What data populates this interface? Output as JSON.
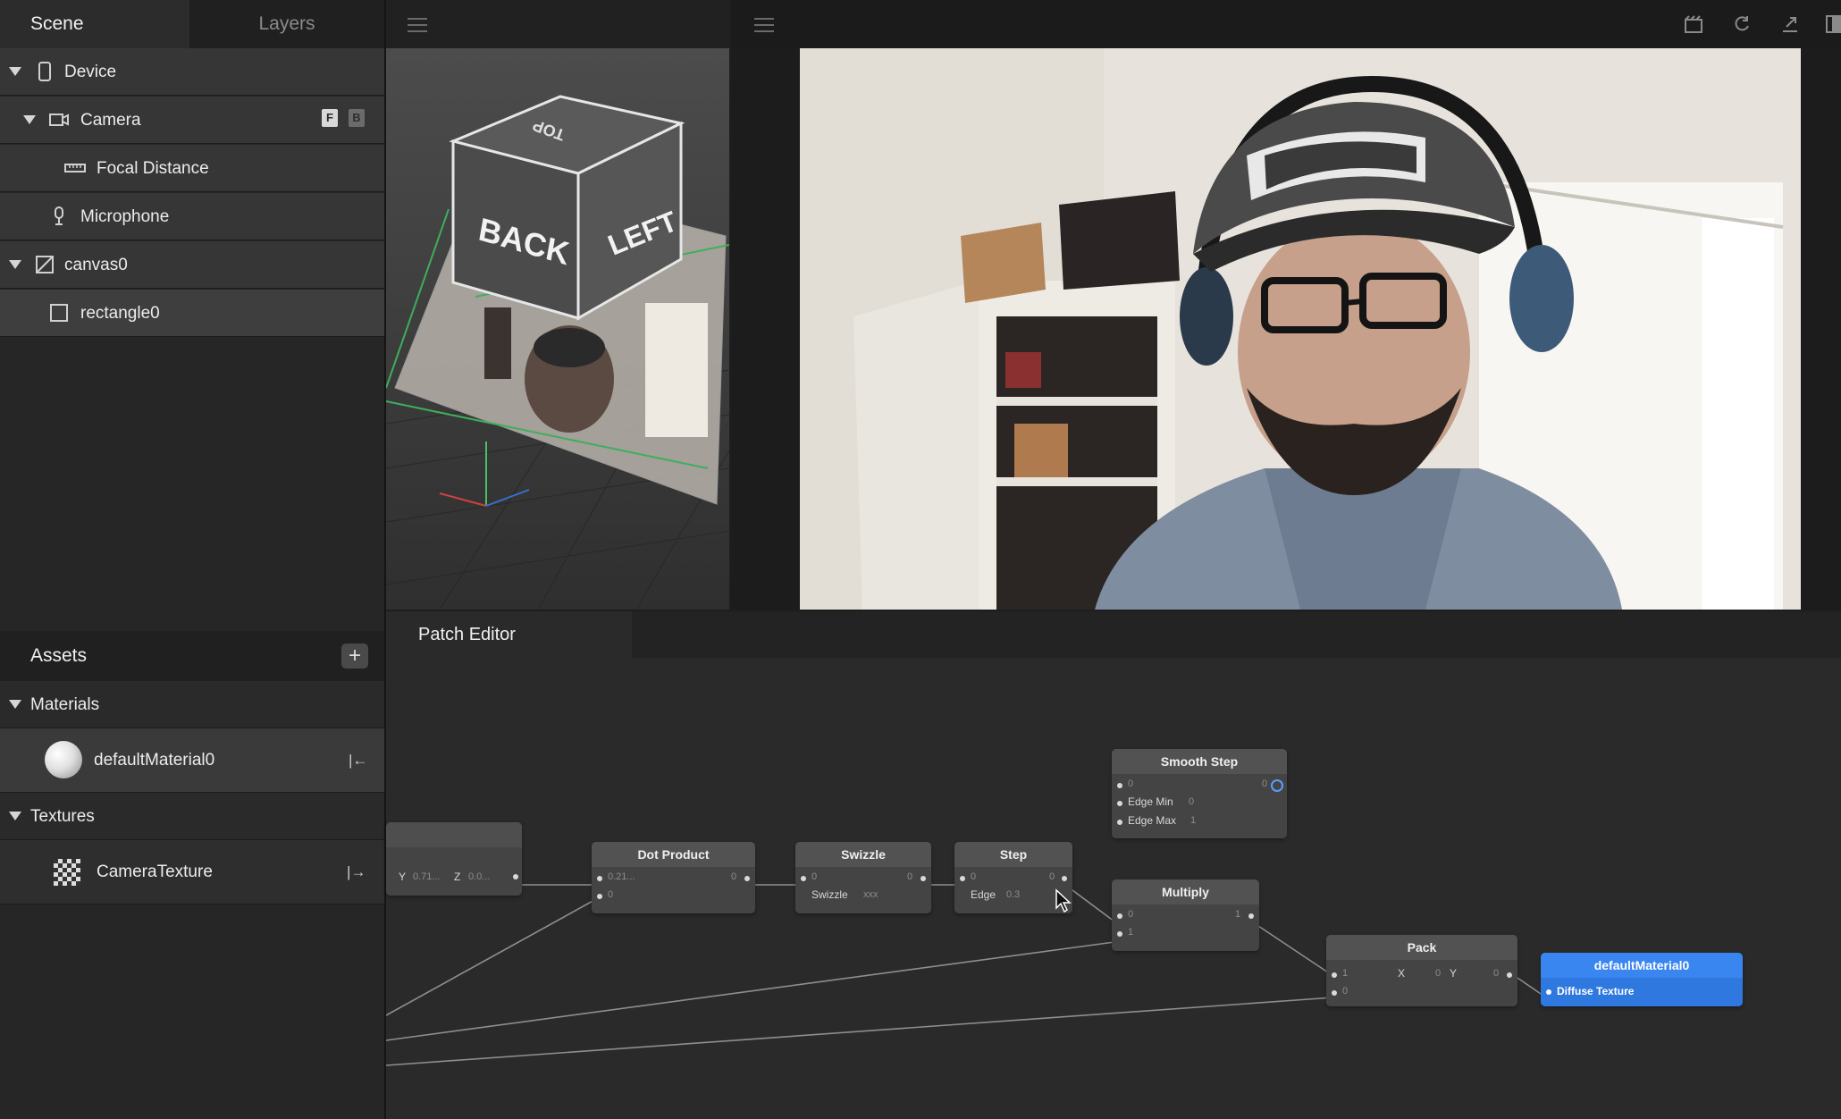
{
  "sidebar": {
    "tabs": [
      "Scene",
      "Layers"
    ],
    "scene_items": [
      {
        "label": "Device",
        "icon": "phone-icon"
      },
      {
        "label": "Camera",
        "icon": "camera-icon",
        "flags": [
          "F",
          "B"
        ]
      },
      {
        "label": "Focal Distance",
        "icon": "ruler-icon"
      },
      {
        "label": "Microphone",
        "icon": "microphone-icon"
      },
      {
        "label": "canvas0",
        "icon": "canvas-icon"
      },
      {
        "label": "rectangle0",
        "icon": "rectangle-icon"
      }
    ],
    "assets": {
      "title": "Assets",
      "add_label": "+",
      "materials_label": "Materials",
      "material": "defaultMaterial0",
      "material_action": "|←",
      "textures_label": "Textures",
      "texture": "CameraTexture",
      "texture_action": "|→"
    }
  },
  "viewport": {
    "cube_faces": {
      "top": "TOP",
      "back": "BACK",
      "left": "LEFT"
    }
  },
  "patch_editor": {
    "title": "Patch Editor",
    "nodes": {
      "partial": {
        "y_label": "Y",
        "y_value": "0.71...",
        "z_label": "Z",
        "z_value": "0.0..."
      },
      "dot_product": {
        "title": "Dot Product",
        "in1": "0.21...",
        "in2": "0",
        "out": "0"
      },
      "swizzle": {
        "title": "Swizzle",
        "in1": "0",
        "param_label": "Swizzle",
        "param_value": "xxx",
        "out": "0"
      },
      "step": {
        "title": "Step",
        "in1": "0",
        "param_label": "Edge",
        "param_value": "0.3",
        "out": "0"
      },
      "smooth_step": {
        "title": "Smooth Step",
        "in1": "0",
        "min_label": "Edge Min",
        "min_value": "0",
        "max_label": "Edge Max",
        "max_value": "1",
        "out": "0"
      },
      "multiply": {
        "title": "Multiply",
        "in1": "0",
        "in2": "1",
        "out": "1"
      },
      "pack": {
        "title": "Pack",
        "in1": "1",
        "in2": "0",
        "x_label": "X",
        "x_value": "0",
        "y_label": "Y",
        "out": "0"
      },
      "material": {
        "title": "defaultMaterial0",
        "port_label": "Diffuse Texture"
      }
    }
  }
}
